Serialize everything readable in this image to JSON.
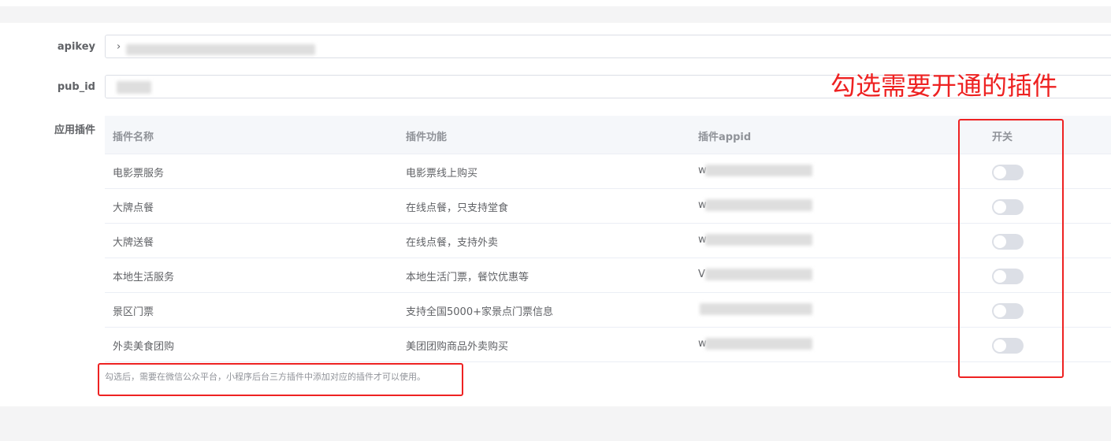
{
  "form": {
    "apikey_label": "apikey",
    "apikey_prefix": "›",
    "pub_id_label": "pub_id",
    "plugins_label": "应用插件"
  },
  "table": {
    "headers": {
      "name": "插件名称",
      "function": "插件功能",
      "appid": "插件appid",
      "switch": "开关"
    },
    "rows": [
      {
        "name": "电影票服务",
        "function": "电影票线上购买",
        "appid_prefix": "w",
        "enabled": false
      },
      {
        "name": "大牌点餐",
        "function": "在线点餐，只支持堂食",
        "appid_prefix": "w",
        "enabled": false
      },
      {
        "name": "大牌送餐",
        "function": "在线点餐，支持外卖",
        "appid_prefix": "w",
        "enabled": false
      },
      {
        "name": "本地生活服务",
        "function": "本地生活门票，餐饮优惠等",
        "appid_prefix": "V",
        "enabled": false
      },
      {
        "name": "景区门票",
        "function": "支持全国5000+家景点门票信息",
        "appid_prefix": "",
        "enabled": false
      },
      {
        "name": "外卖美食团购",
        "function": "美团团购商品外卖购买",
        "appid_prefix": "w",
        "enabled": false
      }
    ]
  },
  "hint": "勾选后，需要在微信公众平台，小程序后台三方插件中添加对应的插件才可以使用。",
  "annotation": "勾选需要开通的插件",
  "colors": {
    "annotation_red": "#ee2222",
    "switch_off": "#dcdfe6",
    "header_bg": "#f5f7fa"
  }
}
